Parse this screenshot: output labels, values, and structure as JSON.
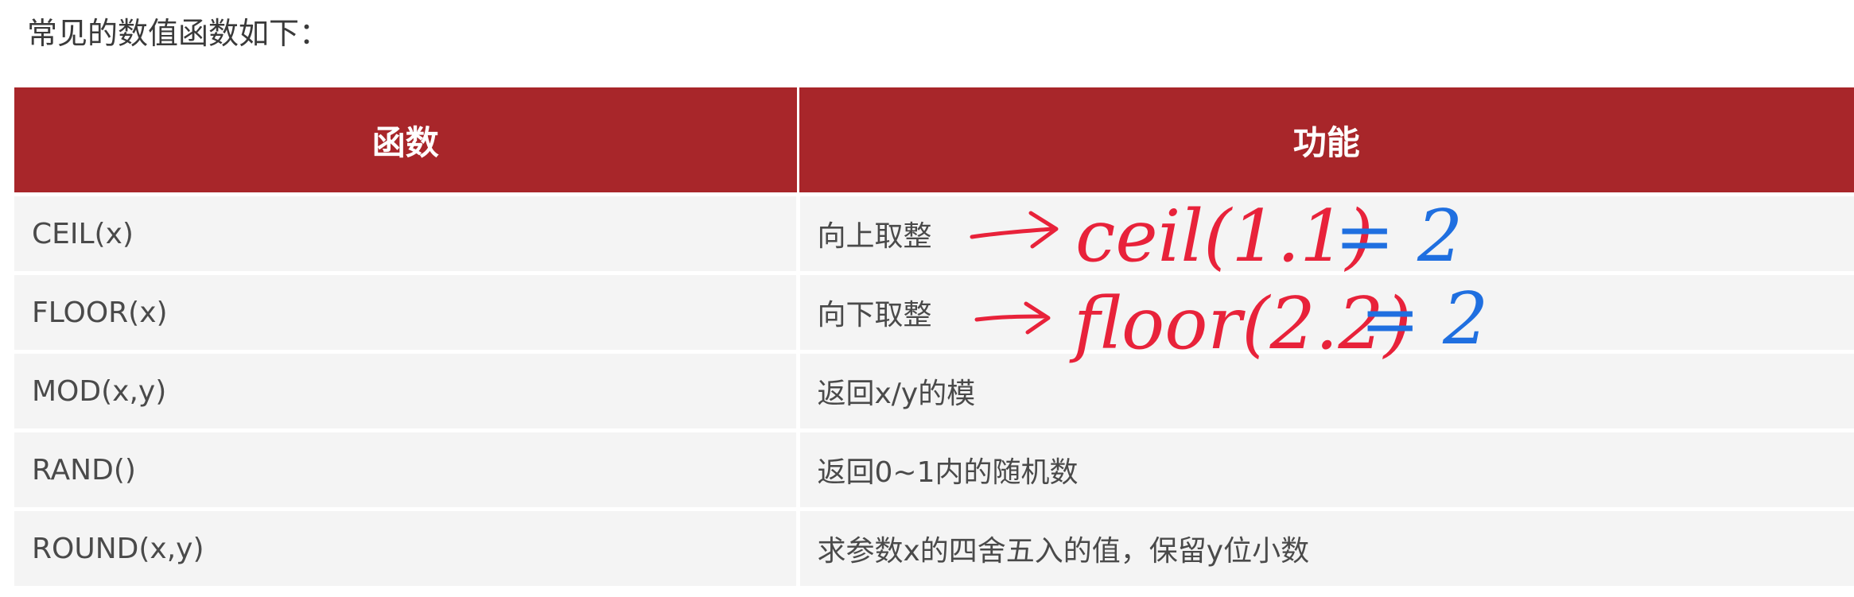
{
  "intro": "常见的数值函数如下：",
  "table": {
    "headers": [
      "函数",
      "功能"
    ],
    "rows": [
      {
        "func": "CEIL(x)",
        "desc": "向上取整"
      },
      {
        "func": "FLOOR(x)",
        "desc": "向下取整"
      },
      {
        "func": "MOD(x,y)",
        "desc": "返回x/y的模"
      },
      {
        "func": "RAND()",
        "desc": "返回0~1内的随机数"
      },
      {
        "func": "ROUND(x,y)",
        "desc": "求参数x的四舍五入的值，保留y位小数"
      }
    ]
  },
  "annotations": {
    "line1_expr": "ceil(1.1)",
    "line1_result": "= 2",
    "line2_expr": "floor(2.2)",
    "line2_result": "= 2",
    "expr_color": "#e8223a",
    "result_color": "#1f6fe0"
  },
  "colors": {
    "header_bg": "#a8262a",
    "row_bg": "#f4f4f4"
  }
}
